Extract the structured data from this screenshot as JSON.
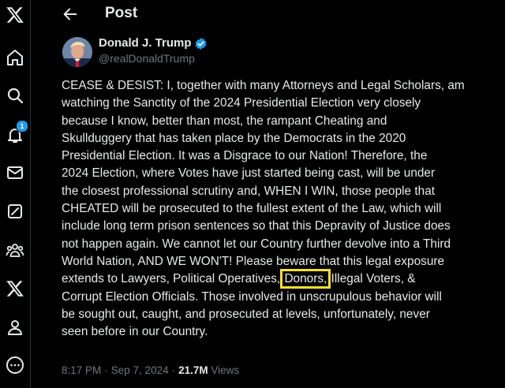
{
  "sidebar": {
    "items": [
      {
        "icon": "x-logo-icon"
      },
      {
        "icon": "home-icon"
      },
      {
        "icon": "search-icon"
      },
      {
        "icon": "notifications-icon",
        "badge": "1"
      },
      {
        "icon": "messages-icon"
      },
      {
        "icon": "grok-icon"
      },
      {
        "icon": "communities-icon"
      },
      {
        "icon": "premium-x-icon"
      },
      {
        "icon": "profile-icon"
      },
      {
        "icon": "more-icon"
      }
    ]
  },
  "header": {
    "title": "Post"
  },
  "post": {
    "author_name": "Donald J. Trump",
    "author_handle": "@realDonaldTrump",
    "verified_color": "#1d9bf0",
    "lines": [
      "CEASE & DESIST: I, together with many Attorneys and Legal Scholars, am",
      "watching the Sanctity of the 2024 Presidential Election very closely",
      "because I know, better than most, the rampant Cheating and",
      "Skullduggery that has taken place by the Democrats in the 2020",
      "Presidential Election. It was a Disgrace to our Nation! Therefore, the",
      "2024 Election, where Votes have just started being cast, will be under",
      "the closest professional scrutiny and, WHEN I WIN, those people that",
      "CHEATED will be prosecuted to the fullest extent of the Law, which will",
      "include long term prison sentences so that this Depravity of Justice does",
      "not happen again. We cannot let our Country further devolve into a Third",
      "World Nation, AND WE WON'T! Please beware that this legal exposure"
    ],
    "line12_before": "extends to Lawyers, Political Operatives, ",
    "line12_highlight": "Donors,",
    "line12_after": " Illegal Voters, &",
    "lines_end": [
      "Corrupt Election Officials. Those involved in unscrupulous behavior will",
      "be sought out, caught, and prosecuted at levels, unfortunately, never",
      "seen before in our Country."
    ],
    "highlight_color": "#f5e22a",
    "time": "8:17 PM",
    "separator": "·",
    "date": "Sep 7, 2024",
    "views_count": "21.7M",
    "views_label": "Views"
  },
  "colors": {
    "background": "#000000",
    "text": "#e7e9ea",
    "secondary_text": "#71767b",
    "accent": "#1d9bf0"
  }
}
